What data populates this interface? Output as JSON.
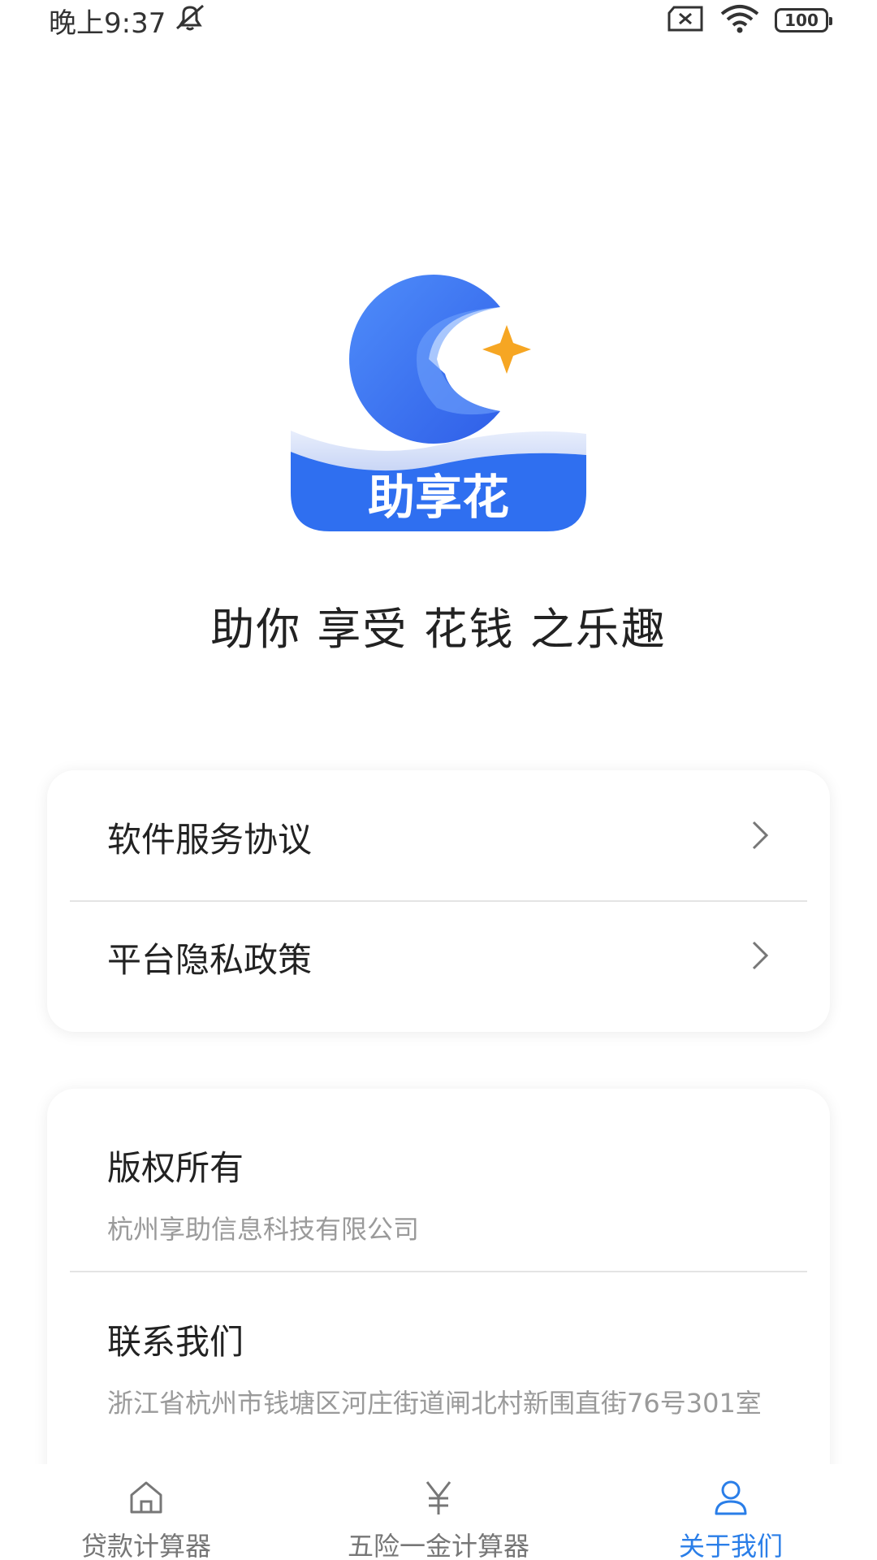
{
  "status_bar": {
    "time": "晚上9:37",
    "battery": "100",
    "icons": [
      "mute-icon",
      "sim-off-icon",
      "wifi-icon",
      "battery-icon"
    ]
  },
  "app": {
    "logo_text": "助享花",
    "slogan": "助你 享受 花钱 之乐趣"
  },
  "links": [
    {
      "label": "软件服务协议"
    },
    {
      "label": "平台隐私政策"
    }
  ],
  "info": {
    "copyright_title": "版权所有",
    "copyright_value": "杭州享助信息科技有限公司",
    "contact_title": "联系我们",
    "contact_value": "浙江省杭州市钱塘区河庄街道闸北村新围直街76号301室"
  },
  "bottom_nav": {
    "items": [
      {
        "label": "贷款计算器",
        "icon": "home-icon"
      },
      {
        "label": "五险一金计算器",
        "icon": "yuan-icon"
      },
      {
        "label": "关于我们",
        "icon": "user-icon"
      }
    ],
    "active_index": 2
  },
  "colors": {
    "accent": "#2a7ee8",
    "logo_blue": "#2f6ff0",
    "star": "#f6a623"
  }
}
